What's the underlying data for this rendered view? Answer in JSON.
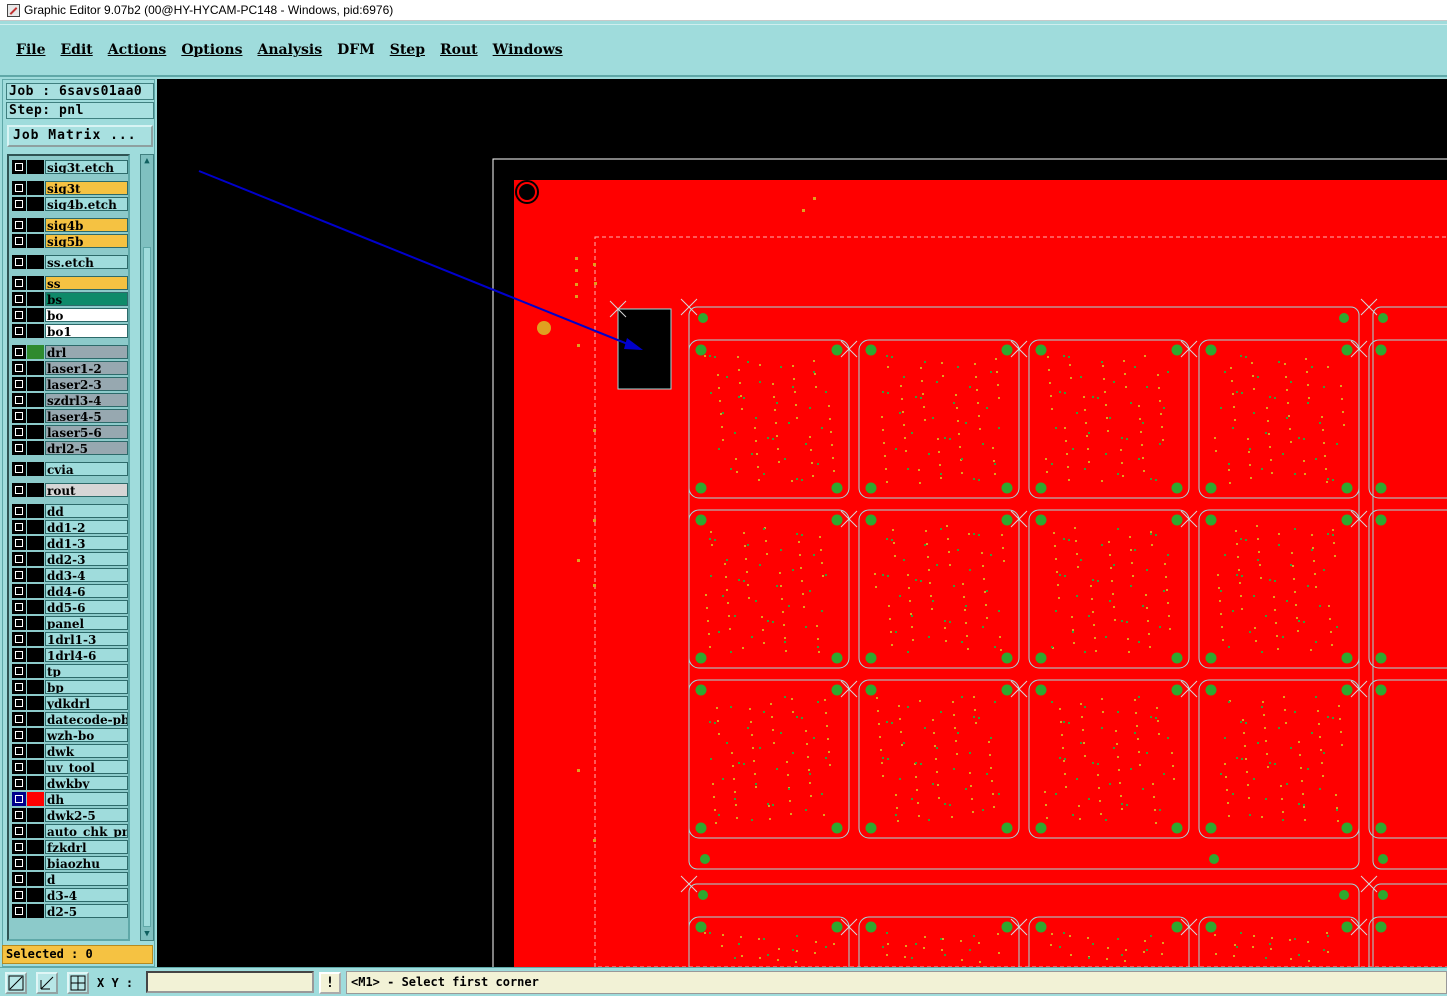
{
  "window": {
    "title": "Graphic Editor 9.07b2 (00@HY-HYCAM-PC148 - Windows, pid:6976)"
  },
  "menu": [
    "File",
    "Edit",
    "Actions",
    "Options",
    "Analysis",
    "DFM",
    "Step",
    "Rout",
    "Windows"
  ],
  "job": {
    "job_line": "Job : 6savs01aa0",
    "step_line": "Step: pnl",
    "matrix_button": "Job Matrix ..."
  },
  "layers": [
    {
      "name": "sig3t.etch",
      "color": "#9fdcdc"
    },
    {
      "name": "sig3t",
      "color": "#f5c242"
    },
    {
      "name": "sig4b.etch",
      "color": "#9fdcdc"
    },
    {
      "name": "sig4b",
      "color": "#f5c242"
    },
    {
      "name": "sig5b",
      "color": "#f5c242"
    },
    {
      "name": "ss.etch",
      "color": "#9fdcdc"
    },
    {
      "name": "ss",
      "color": "#f5c242"
    },
    {
      "name": "bs",
      "color": "#0e8a6a"
    },
    {
      "name": "bo",
      "color": "#ffffff"
    },
    {
      "name": "bo1",
      "color": "#ffffff"
    },
    {
      "name": "drl",
      "color": "#97a8b0"
    },
    {
      "name": "laser1-2",
      "color": "#97a8b0"
    },
    {
      "name": "laser2-3",
      "color": "#97a8b0"
    },
    {
      "name": "szdrl3-4",
      "color": "#97a8b0"
    },
    {
      "name": "laser4-5",
      "color": "#97a8b0"
    },
    {
      "name": "laser5-6",
      "color": "#97a8b0"
    },
    {
      "name": "drl2-5",
      "color": "#97a8b0"
    },
    {
      "name": "cvia",
      "color": "#9fdcdc"
    },
    {
      "name": "rout",
      "color": "#d6d6d6"
    },
    {
      "name": "dd",
      "color": "#9fdcdc"
    },
    {
      "name": "dd1-2",
      "color": "#9fdcdc"
    },
    {
      "name": "dd1-3",
      "color": "#9fdcdc"
    },
    {
      "name": "dd2-3",
      "color": "#9fdcdc"
    },
    {
      "name": "dd3-4",
      "color": "#9fdcdc"
    },
    {
      "name": "dd4-6",
      "color": "#9fdcdc"
    },
    {
      "name": "dd5-6",
      "color": "#9fdcdc"
    },
    {
      "name": "panel",
      "color": "#9fdcdc"
    },
    {
      "name": "1drl1-3",
      "color": "#9fdcdc"
    },
    {
      "name": "1drl4-6",
      "color": "#9fdcdc"
    },
    {
      "name": "tp",
      "color": "#9fdcdc"
    },
    {
      "name": "bp",
      "color": "#9fdcdc"
    },
    {
      "name": "ydkdrl",
      "color": "#9fdcdc"
    },
    {
      "name": "datecode-pbc",
      "color": "#9fdcdc"
    },
    {
      "name": "wzh-bo",
      "color": "#9fdcdc"
    },
    {
      "name": "dwk",
      "color": "#9fdcdc"
    },
    {
      "name": "uv_tool",
      "color": "#9fdcdc"
    },
    {
      "name": "dwkby",
      "color": "#9fdcdc"
    },
    {
      "name": "dh",
      "color": "#9fdcdc",
      "active": true
    },
    {
      "name": "dwk2-5",
      "color": "#9fdcdc"
    },
    {
      "name": "auto_chk_pnl",
      "color": "#9fdcdc"
    },
    {
      "name": "fzkdrl",
      "color": "#9fdcdc"
    },
    {
      "name": "biaozhu",
      "color": "#9fdcdc"
    },
    {
      "name": "d",
      "color": "#9fdcdc"
    },
    {
      "name": "d3-4",
      "color": "#9fdcdc"
    },
    {
      "name": "d2-5",
      "color": "#9fdcdc"
    }
  ],
  "selected": "Selected : 0",
  "status": {
    "xy_label": "X Y :",
    "xy_value": "",
    "alert": "!",
    "message": "<M1> - Select first corner"
  },
  "colors": {
    "canvas_bg": "#000000",
    "board": "#ff0000",
    "pad_green": "#2fa82f",
    "via_yellow": "#e0a020",
    "outline": "#9fdcdc",
    "arrow": "#0000cc",
    "ui_bg": "#9fdcdc"
  }
}
